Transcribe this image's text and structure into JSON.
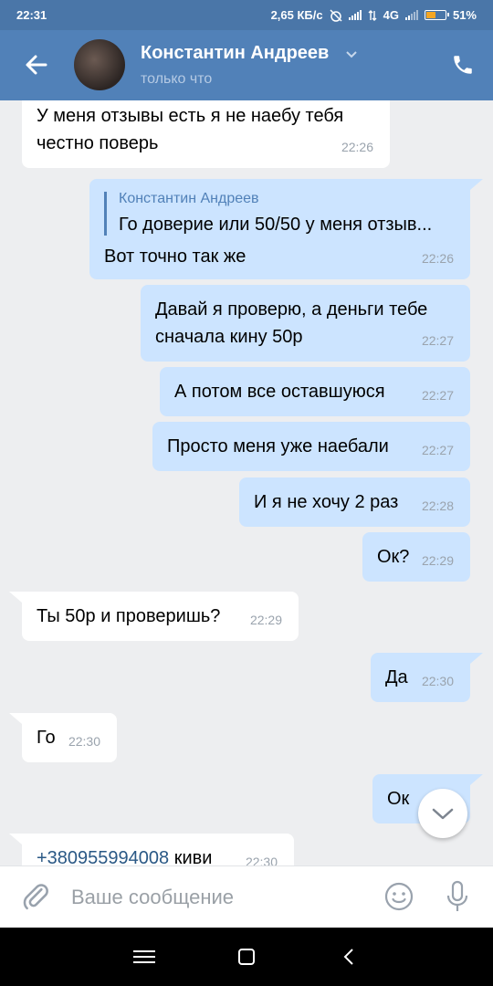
{
  "status_bar": {
    "time": "22:31",
    "speed": "2,65 КБ/с",
    "network": "4G",
    "battery": "51%",
    "battery_level": 0.51
  },
  "header": {
    "name": "Константин Андреев",
    "status": "только что",
    "icons": [
      "back-arrow-icon",
      "chevron-down-icon",
      "phone-icon"
    ]
  },
  "messages": [
    {
      "dir": "in",
      "text_1": "У меня отзывы есть я не наебу тебя",
      "text_2": "честно поверь",
      "time": "22:26"
    },
    {
      "dir": "out",
      "reply_name": "Константин Андреев",
      "reply_text": "Го доверие или 50/50 у меня отзыв...",
      "text": "Вот точно так же",
      "time": "22:26"
    },
    {
      "dir": "out",
      "text_1": "Давай я проверю, а деньги тебе",
      "text_2": "сначала кину 50р",
      "time": "22:27"
    },
    {
      "dir": "out",
      "text": "А потом все оставшуюся",
      "time": "22:27"
    },
    {
      "dir": "out",
      "text": "Просто меня уже наебали",
      "time": "22:27"
    },
    {
      "dir": "out",
      "text": "И я не хочу 2 раз",
      "time": "22:28"
    },
    {
      "dir": "out",
      "text": "Ок?",
      "time": "22:29"
    },
    {
      "dir": "in",
      "text": "Ты 50р и проверишь?",
      "time": "22:29"
    },
    {
      "dir": "out",
      "text": "Да",
      "time": "22:30"
    },
    {
      "dir": "in",
      "text": "Го",
      "time": "22:30"
    },
    {
      "dir": "out",
      "text": "Ок",
      "time": ""
    },
    {
      "dir": "in",
      "link": "+380955994008",
      "text": " киви",
      "time": "22:30"
    }
  ],
  "input": {
    "placeholder": "Ваше сообщение",
    "icons": [
      "attach-icon",
      "smile-icon",
      "mic-icon"
    ]
  },
  "scroll_down_icon": "chevron-down-icon",
  "nav_bar": {
    "icons": [
      "menu-icon",
      "home-icon",
      "back-icon"
    ]
  },
  "colors": {
    "header": "#5181b8",
    "status_bar": "#4a76a8",
    "outgoing": "#cce4ff",
    "incoming": "#ffffff",
    "background": "#edeef0",
    "link": "#2a5885"
  }
}
